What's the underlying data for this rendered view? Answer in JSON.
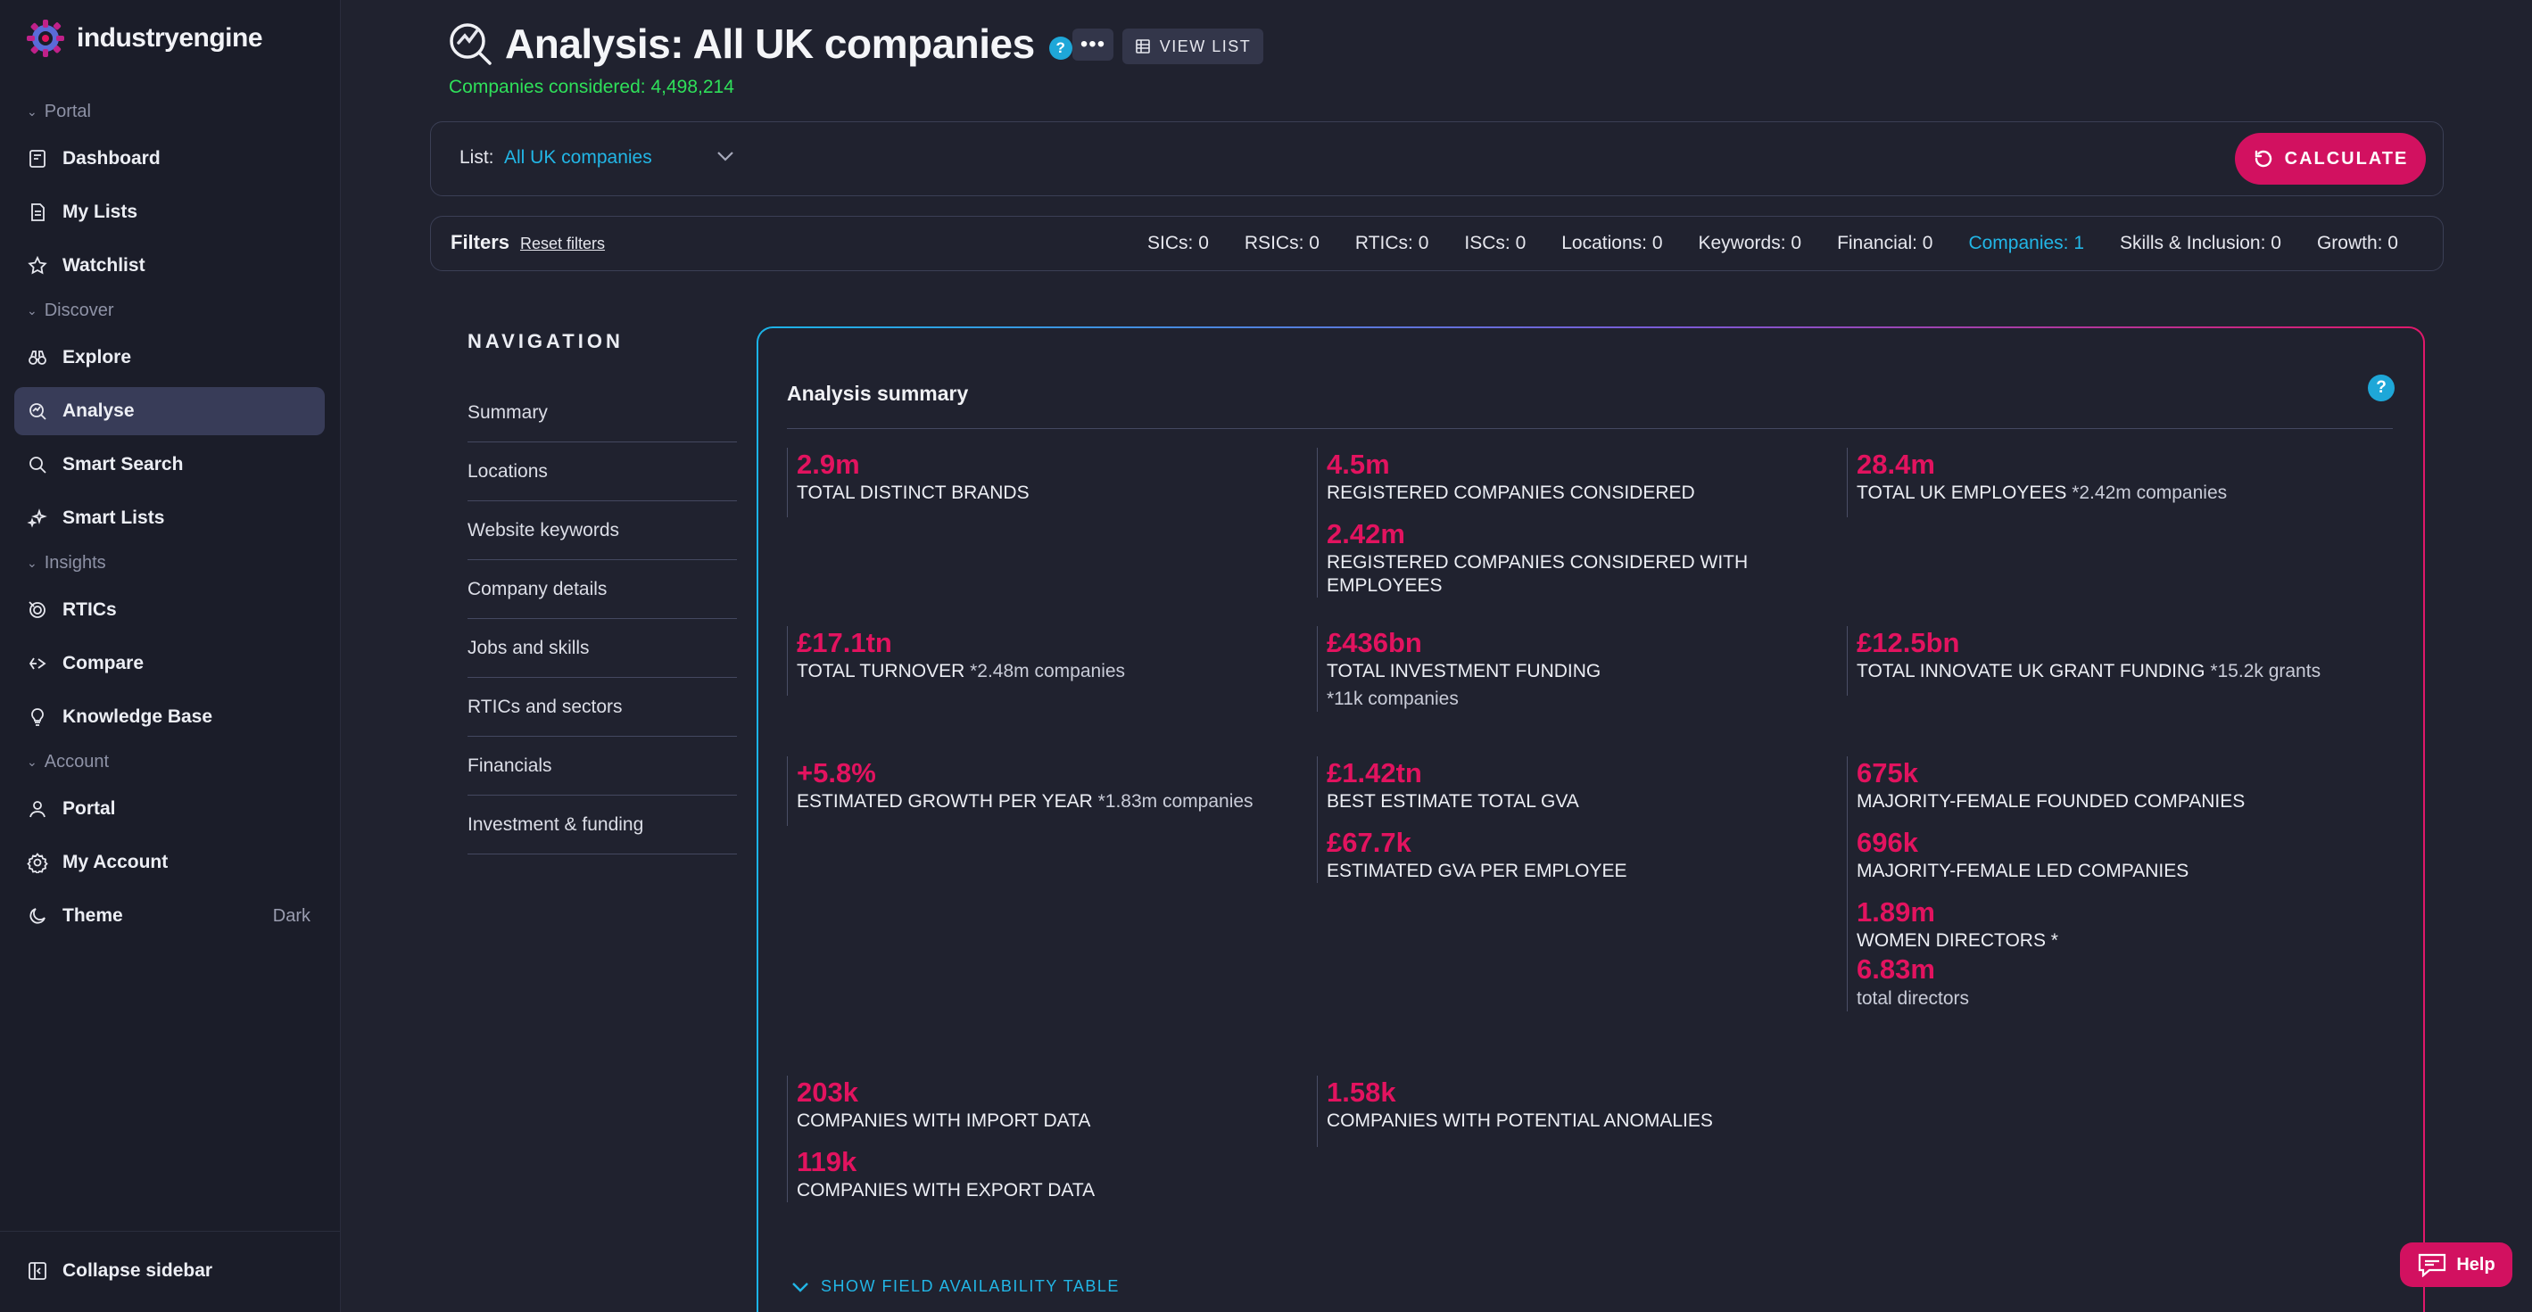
{
  "app": {
    "brand": "industryengine"
  },
  "sidebar": {
    "sections": {
      "portal": "Portal",
      "discover": "Discover",
      "insights": "Insights",
      "account": "Account"
    },
    "items": {
      "dashboard": "Dashboard",
      "my_lists": "My Lists",
      "watchlist": "Watchlist",
      "explore": "Explore",
      "analyse": "Analyse",
      "smart_search": "Smart Search",
      "smart_lists": "Smart Lists",
      "rtics": "RTICs",
      "compare": "Compare",
      "knowledge_base": "Knowledge Base",
      "portal": "Portal",
      "my_account": "My Account",
      "theme": "Theme",
      "theme_value": "Dark"
    },
    "collapse": "Collapse sidebar",
    "active_item": "Analyse"
  },
  "header": {
    "title": "Analysis: All UK companies",
    "help": "?",
    "more": "•••",
    "view_list": "VIEW LIST",
    "companies_considered": "Companies considered: 4,498,214"
  },
  "listbar": {
    "label": "List:",
    "value": "All UK companies",
    "calculate": "CALCULATE"
  },
  "filters": {
    "title": "Filters",
    "reset": "Reset filters",
    "stats": {
      "sics": "SICs: 0",
      "rsics": "RSICs: 0",
      "rtics": "RTICs: 0",
      "iscs": "ISCs: 0",
      "locations": "Locations: 0",
      "keywords": "Keywords: 0",
      "financial": "Financial: 0",
      "companies": "Companies: 1",
      "skills": "Skills & Inclusion: 0",
      "growth": "Growth: 0"
    }
  },
  "navigation": {
    "heading": "NAVIGATION",
    "items": {
      "summary": "Summary",
      "locations": "Locations",
      "website_keywords": "Website keywords",
      "company_details": "Company details",
      "jobs_skills": "Jobs and skills",
      "rtics_sectors": "RTICs and sectors",
      "financials": "Financials",
      "investment": "Investment & funding"
    }
  },
  "summary": {
    "title": "Analysis summary",
    "help": "?",
    "stats": {
      "brands": {
        "value": "2.9m",
        "label": "TOTAL DISTINCT BRANDS"
      },
      "registered": {
        "value": "4.5m",
        "label": "REGISTERED COMPANIES CONSIDERED"
      },
      "registered_emp": {
        "value": "2.42m",
        "label": "REGISTERED COMPANIES CONSIDERED WITH EMPLOYEES"
      },
      "employees": {
        "value": "28.4m",
        "label": "TOTAL UK EMPLOYEES",
        "note": "*2.42m companies"
      },
      "turnover": {
        "value": "£17.1tn",
        "label": "TOTAL TURNOVER",
        "note": "*2.48m companies"
      },
      "investment": {
        "value": "£436bn",
        "label": "TOTAL INVESTMENT FUNDING",
        "note": "*11k companies"
      },
      "grant": {
        "value": "£12.5bn",
        "label": "TOTAL INNOVATE UK GRANT FUNDING",
        "note": "*15.2k grants"
      },
      "growth": {
        "value": "+5.8%",
        "label": "ESTIMATED GROWTH PER YEAR",
        "note": "*1.83m companies"
      },
      "gva": {
        "value": "£1.42tn",
        "label": "BEST ESTIMATE TOTAL GVA"
      },
      "gva_emp": {
        "value": "£67.7k",
        "label": "ESTIMATED GVA PER EMPLOYEE"
      },
      "female_founded": {
        "value": "675k",
        "label": "MAJORITY-FEMALE FOUNDED COMPANIES"
      },
      "female_led": {
        "value": "696k",
        "label": "MAJORITY-FEMALE LED COMPANIES"
      },
      "women_directors": {
        "value": "1.89m",
        "label": "WOMEN DIRECTORS *"
      },
      "total_directors": {
        "value": "6.83m",
        "label": "total directors"
      },
      "import": {
        "value": "203k",
        "label": "COMPANIES WITH IMPORT DATA"
      },
      "export": {
        "value": "119k",
        "label": "COMPANIES WITH EXPORT DATA"
      },
      "anomalies": {
        "value": "1.58k",
        "label": "COMPANIES WITH POTENTIAL ANOMALIES"
      }
    },
    "show_table": "SHOW FIELD AVAILABILITY TABLE"
  },
  "help_button": "Help",
  "colors": {
    "accent_pink": "#e2135f",
    "accent_cyan": "#22b6e6",
    "success_green": "#2fe05a",
    "background": "#20222f",
    "sidebar": "#1b1d29"
  }
}
